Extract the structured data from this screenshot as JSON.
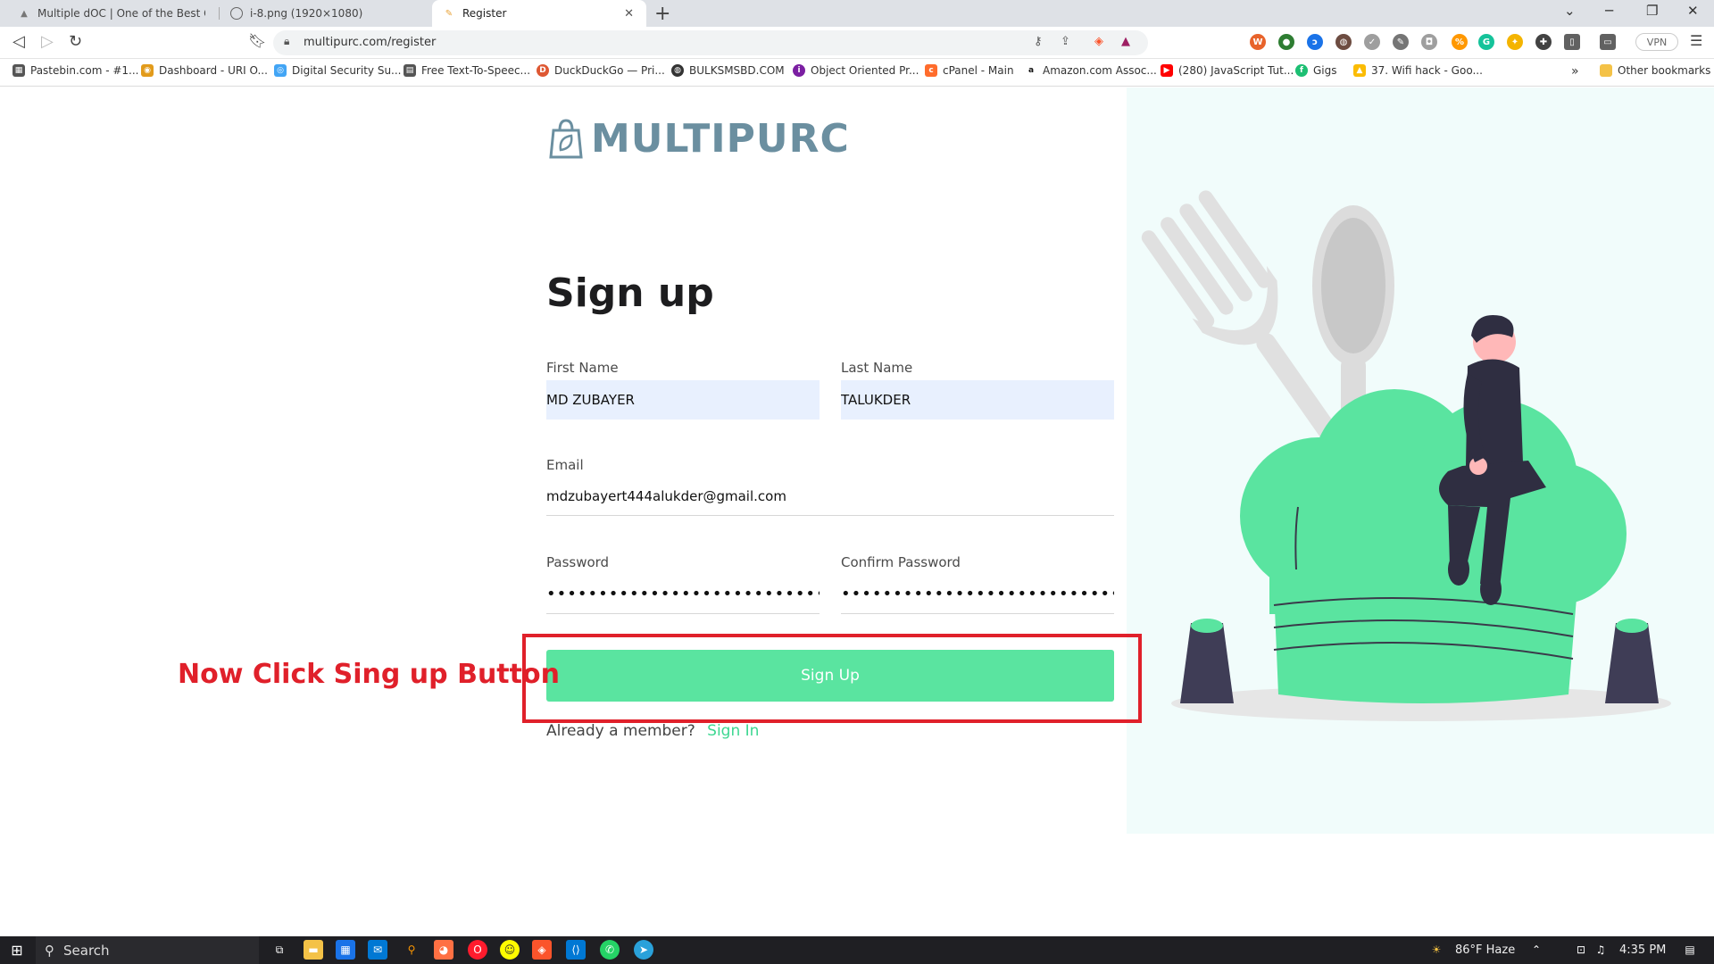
{
  "browser": {
    "tabs": [
      {
        "title": "Multiple dOC | One of the Best Online",
        "active": false
      },
      {
        "title": "i-8.png (1920×1080)",
        "active": false
      },
      {
        "title": "Register",
        "active": true
      }
    ],
    "address": "multipurc.com/register",
    "bookmarks": [
      "Pastebin.com - #1...",
      "Dashboard - URI O...",
      "Digital Security Su...",
      "Free Text-To-Speec...",
      "DuckDuckGo — Pri...",
      "BULKSMSBD.COM",
      "Object Oriented Pr...",
      "cPanel - Main",
      "Amazon.com Assoc...",
      "(280) JavaScript Tut...",
      "Gigs",
      "37. Wifi hack - Goo..."
    ],
    "other_bookmarks": "Other bookmarks",
    "vpn_label": "VPN"
  },
  "page": {
    "logo_text": "MULTIPURC",
    "title": "Sign up",
    "form": {
      "first_name_label": "First Name",
      "first_name_value": "MD ZUBAYER",
      "last_name_label": "Last Name",
      "last_name_value": "TALUKDER",
      "email_label": "Email",
      "email_value": "mdzubayert444alukder@gmail.com",
      "password_label": "Password",
      "password_value": "••••••••••••••••••••••••••••••",
      "confirm_password_label": "Confirm Password",
      "confirm_password_value": "••••••••••••••••••••••••••••••",
      "submit_label": "Sign Up",
      "member_text": "Already a member?",
      "signin_link": "Sign In"
    },
    "annotation": "Now Click Sing up Button",
    "colors": {
      "accent": "#5ae4a0",
      "annotation_red": "#e0202a",
      "illustration_bg": "#f1fcfb"
    }
  },
  "taskbar": {
    "search_label": "Search",
    "weather": "86°F  Haze",
    "time": "4:35 PM"
  }
}
